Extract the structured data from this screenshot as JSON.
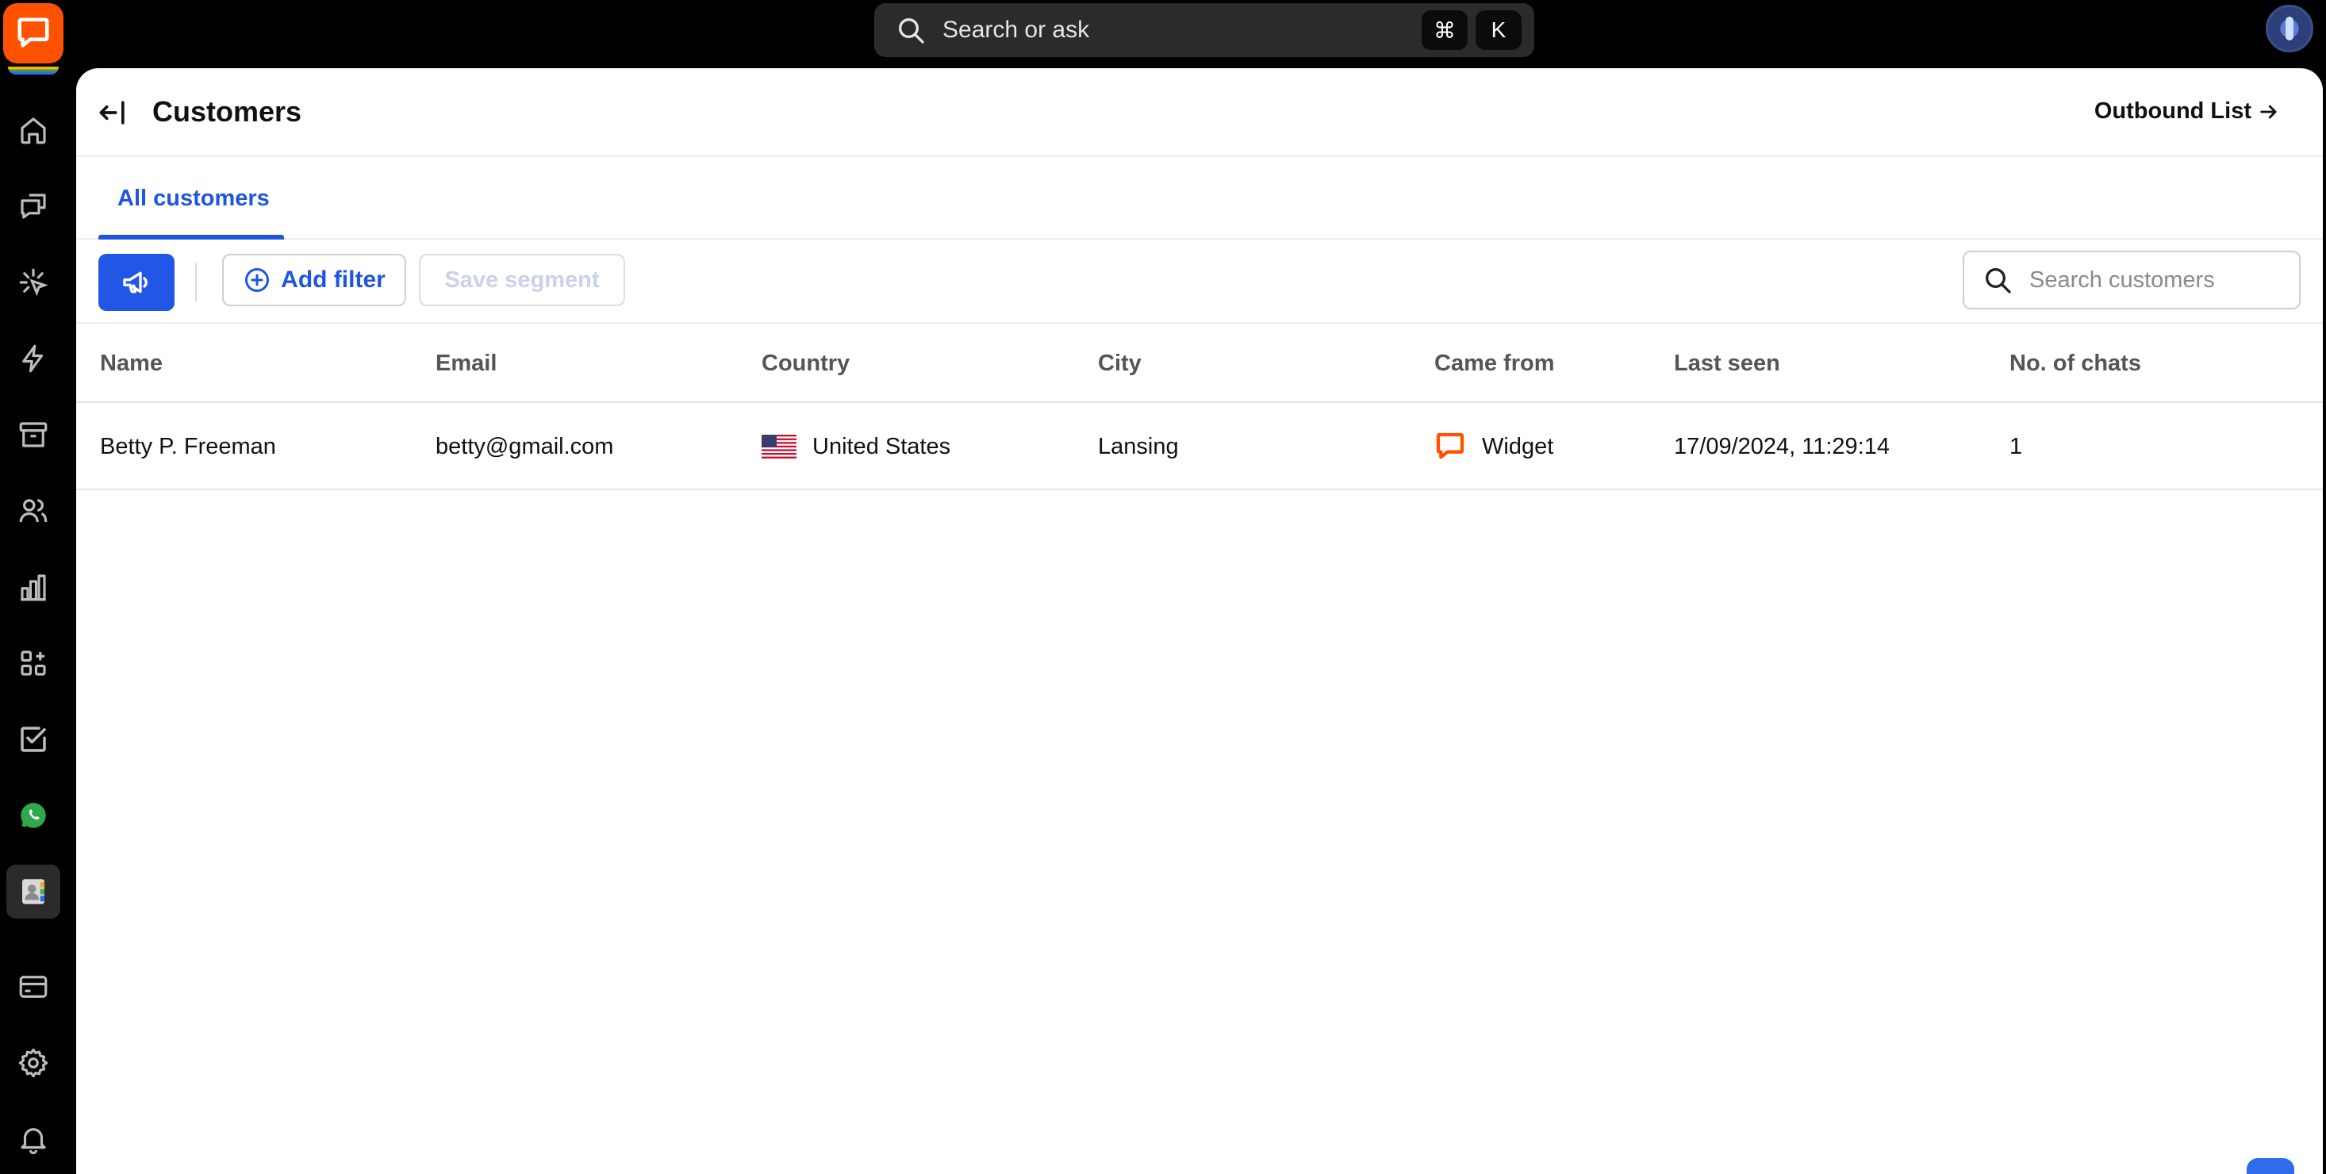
{
  "global_search": {
    "placeholder": "Search or ask",
    "shortcut_keys": [
      "⌘",
      "K"
    ]
  },
  "nav": {
    "items": [
      {
        "icon": "home-icon"
      },
      {
        "icon": "chats-icon"
      },
      {
        "icon": "engage-icon"
      },
      {
        "icon": "automation-bolt-icon"
      },
      {
        "icon": "archive-icon"
      },
      {
        "icon": "team-icon"
      },
      {
        "icon": "reports-icon"
      },
      {
        "icon": "apps-icon"
      },
      {
        "icon": "tasks-check-icon"
      },
      {
        "icon": "whatsapp-icon"
      },
      {
        "icon": "customers-contacts-icon",
        "active": true
      },
      {
        "icon": "billing-card-icon"
      },
      {
        "icon": "settings-gear-icon"
      },
      {
        "icon": "notifications-bell-icon"
      }
    ]
  },
  "header": {
    "title": "Customers",
    "outbound_link": "Outbound List"
  },
  "tabs": [
    {
      "label": "All customers",
      "active": true
    }
  ],
  "toolbar": {
    "add_filter": "Add filter",
    "save_segment": "Save segment",
    "search_placeholder": "Search customers"
  },
  "table": {
    "columns": [
      "Name",
      "Email",
      "Country",
      "City",
      "Came from",
      "Last seen",
      "No. of chats"
    ],
    "rows": [
      {
        "name": "Betty P. Freeman",
        "email": "betty@gmail.com",
        "country": "United States",
        "city": "Lansing",
        "came_from": "Widget",
        "last_seen": "17/09/2024, 11:29:14",
        "chats": "1"
      }
    ]
  },
  "colors": {
    "accent": "#2256e6",
    "brand": "#ff5100"
  }
}
